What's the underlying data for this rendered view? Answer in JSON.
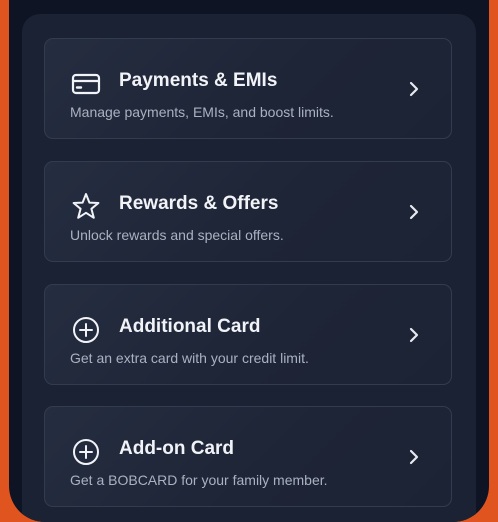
{
  "menu": {
    "items": [
      {
        "title": "Payments & EMIs",
        "subtitle": "Manage payments, EMIs, and boost limits.",
        "icon": "credit-card-icon"
      },
      {
        "title": "Rewards & Offers",
        "subtitle": "Unlock rewards and special offers.",
        "icon": "star-icon"
      },
      {
        "title": "Additional Card",
        "subtitle": "Get an extra card with your credit limit.",
        "icon": "plus-circle-icon"
      },
      {
        "title": "Add-on Card",
        "subtitle": "Get a BOBCARD for your family member.",
        "icon": "plus-circle-icon"
      }
    ]
  },
  "colors": {
    "background_accent": "#e0541f",
    "screen_background": "#0e1424",
    "panel_background": "#1b2233",
    "card_border": "#333c4f",
    "title_text": "#f1f3f7",
    "subtitle_text": "#aab1c0"
  }
}
